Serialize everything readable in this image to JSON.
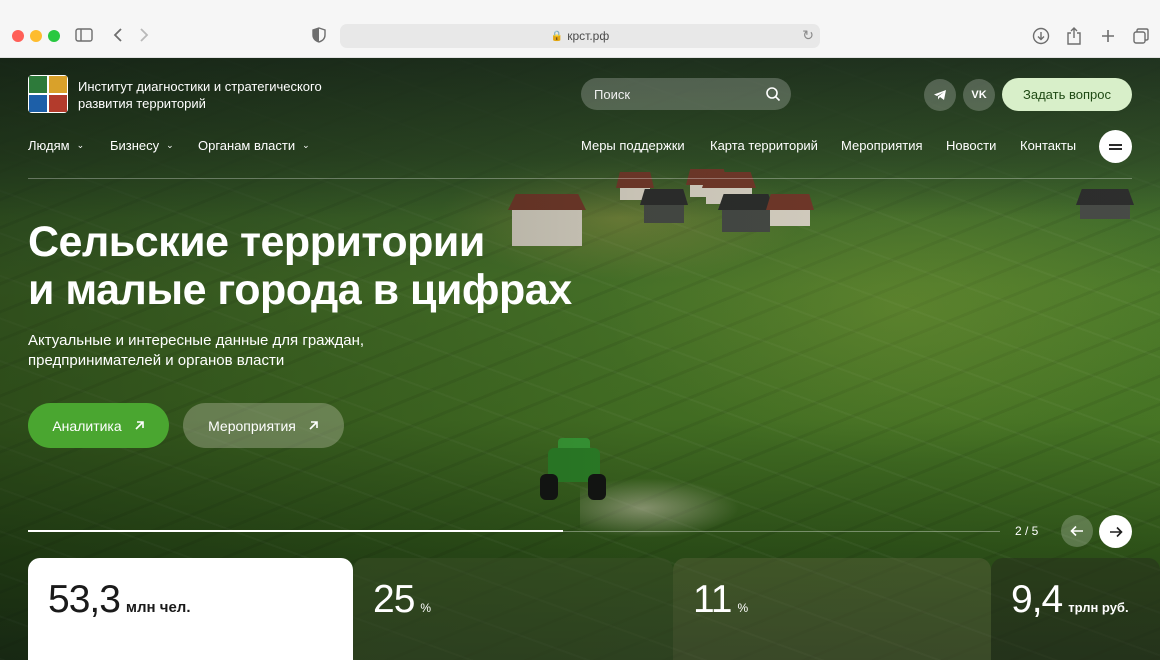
{
  "browser": {
    "url": "крст.рф"
  },
  "header": {
    "org_name": "Институт диагностики и стратегического развития территорий",
    "search_placeholder": "Поиск",
    "telegram": "telegram-icon",
    "vk_label": "VK",
    "ask_button": "Задать вопрос"
  },
  "nav": {
    "left": [
      {
        "label": "Людям"
      },
      {
        "label": "Бизнесу"
      },
      {
        "label": "Органам власти"
      }
    ],
    "right": [
      {
        "label": "Меры поддержки"
      },
      {
        "label": "Карта территорий"
      },
      {
        "label": "Мероприятия"
      },
      {
        "label": "Новости"
      },
      {
        "label": "Контакты"
      }
    ]
  },
  "hero": {
    "title_line1": "Сельские территории",
    "title_line2": "и малые города в цифрах",
    "subtitle_line1": "Актуальные и интересные данные для граждан,",
    "subtitle_line2": "предпринимателей и органов власти",
    "btn_analytics": "Аналитика",
    "btn_events": "Мероприятия",
    "slide_counter": "2 / 5",
    "slide_progress": 0.55
  },
  "stats": [
    {
      "value": "53,3",
      "unit": "млн чел."
    },
    {
      "value": "25",
      "unit": "%"
    },
    {
      "value": "11",
      "unit": "%"
    },
    {
      "value": "9,4",
      "unit": "трлн руб."
    }
  ],
  "colors": {
    "accent_green": "#4aa630",
    "ask_button_bg": "#d8efc9"
  }
}
